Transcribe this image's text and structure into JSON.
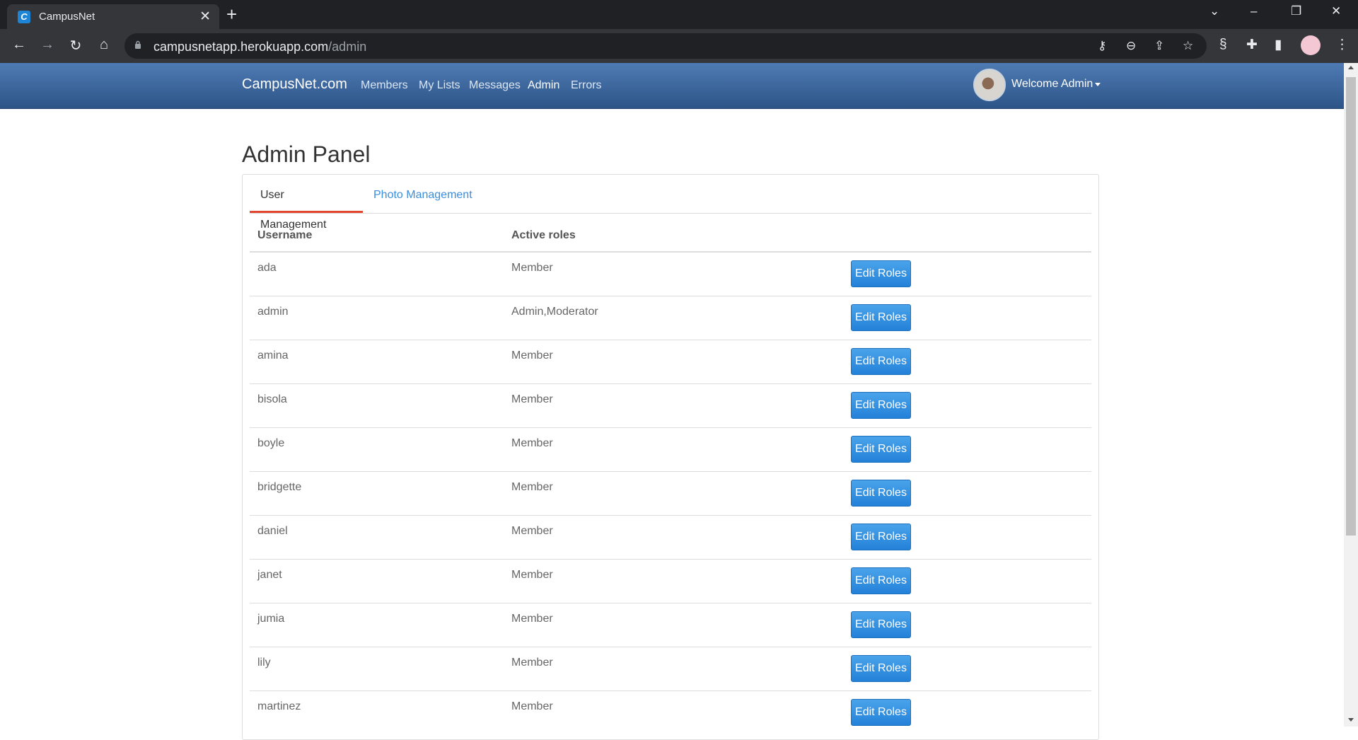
{
  "browser": {
    "tab_title": "CampusNet",
    "url_domain": "campusnetapp.herokuapp.com",
    "url_path": "/admin"
  },
  "site": {
    "brand": "CampusNet.com",
    "nav": [
      "Members",
      "My Lists",
      "Messages",
      "Admin",
      "Errors"
    ],
    "active_nav": "Admin",
    "welcome": "Welcome Admin"
  },
  "page": {
    "title": "Admin Panel",
    "tabs": [
      {
        "label": "User Management",
        "active": true
      },
      {
        "label": "Photo Management",
        "active": false
      }
    ]
  },
  "table": {
    "headers": [
      "Username",
      "Active roles",
      ""
    ],
    "button_label": "Edit Roles",
    "rows": [
      {
        "username": "ada",
        "roles": "Member"
      },
      {
        "username": "admin",
        "roles": "Admin,Moderator"
      },
      {
        "username": "amina",
        "roles": "Member"
      },
      {
        "username": "bisola",
        "roles": "Member"
      },
      {
        "username": "boyle",
        "roles": "Member"
      },
      {
        "username": "bridgette",
        "roles": "Member"
      },
      {
        "username": "daniel",
        "roles": "Member"
      },
      {
        "username": "janet",
        "roles": "Member"
      },
      {
        "username": "jumia",
        "roles": "Member"
      },
      {
        "username": "lily",
        "roles": "Member"
      },
      {
        "username": "martinez",
        "roles": "Member"
      }
    ]
  },
  "colors": {
    "navbar": "#3a639b",
    "tab_active_underline": "#e2462e",
    "link": "#3c8edb",
    "button": "#2e8ee0"
  }
}
